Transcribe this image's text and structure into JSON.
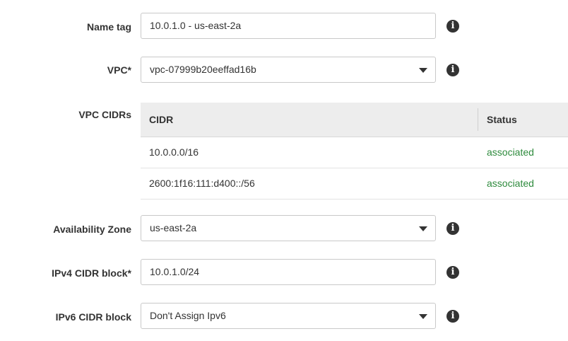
{
  "form": {
    "name_tag": {
      "label": "Name tag",
      "value": "10.0.1.0 - us-east-2a"
    },
    "vpc": {
      "label": "VPC*",
      "value": "vpc-07999b20eeffad16b"
    },
    "vpc_cidrs": {
      "label": "VPC CIDRs",
      "columns": [
        "CIDR",
        "Status"
      ],
      "rows": [
        {
          "cidr": "10.0.0.0/16",
          "status": "associated"
        },
        {
          "cidr": "2600:1f16:111:d400::/56",
          "status": "associated"
        }
      ]
    },
    "availability_zone": {
      "label": "Availability Zone",
      "value": "us-east-2a"
    },
    "ipv4_cidr": {
      "label": "IPv4 CIDR block*",
      "value": "10.0.1.0/24"
    },
    "ipv6_cidr": {
      "label": "IPv6 CIDR block",
      "value": "Don't Assign Ipv6"
    }
  },
  "icons": {
    "info": "info-icon",
    "dropdown": "chevron-down-icon"
  },
  "colors": {
    "status_associated": "#2e8b3d",
    "table_header_bg": "#ededed",
    "info_icon": "#333333"
  }
}
